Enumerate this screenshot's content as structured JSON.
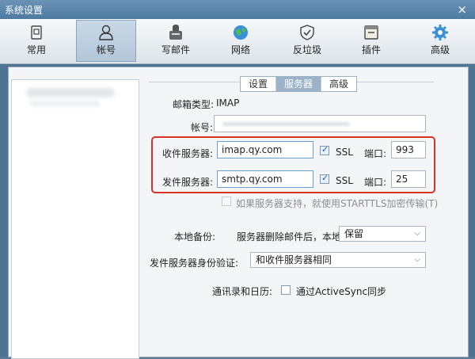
{
  "window": {
    "title": "系统设置",
    "close": "×"
  },
  "toolbar": {
    "items": [
      {
        "label": "常用",
        "icon": "general-icon"
      },
      {
        "label": "帐号",
        "icon": "account-icon"
      },
      {
        "label": "写邮件",
        "icon": "compose-icon"
      },
      {
        "label": "网络",
        "icon": "network-icon"
      },
      {
        "label": "反垃圾",
        "icon": "antispam-icon"
      },
      {
        "label": "插件",
        "icon": "plugin-icon"
      },
      {
        "label": "高级",
        "icon": "advanced-icon"
      }
    ],
    "active": "帐号"
  },
  "tabs": [
    {
      "label": "设置",
      "selected": false
    },
    {
      "label": "服务器",
      "selected": true
    },
    {
      "label": "高级",
      "selected": false
    }
  ],
  "form": {
    "mail_type_label": "邮箱类型:",
    "mail_type_value": "IMAP",
    "account_label": "帐号:",
    "incoming_label": "收件服务器:",
    "incoming_value": "imap.qy.com",
    "incoming_ssl": "SSL",
    "incoming_port_label": "端口:",
    "incoming_port": "993",
    "outgoing_label": "发件服务器:",
    "outgoing_value": "smtp.qy.com",
    "outgoing_ssl": "SSL",
    "outgoing_port_label": "端口:",
    "outgoing_port": "25",
    "starttls_label": "如果服务器支持，就使用STARTTLS加密传输(T)",
    "backup_label": "本地备份:",
    "backup_desc": "服务器删除邮件后，本地",
    "backup_value": "保留",
    "auth_label": "发件服务器身份验证:",
    "auth_value": "和收件服务器相同",
    "contacts_label": "通讯录和日历:",
    "activesync_label": "通过ActiveSync同步"
  },
  "colors": {
    "highlight": "#d9302a",
    "tab_selected": "#9bb2c9",
    "titlebar": "#4f7aa0"
  }
}
